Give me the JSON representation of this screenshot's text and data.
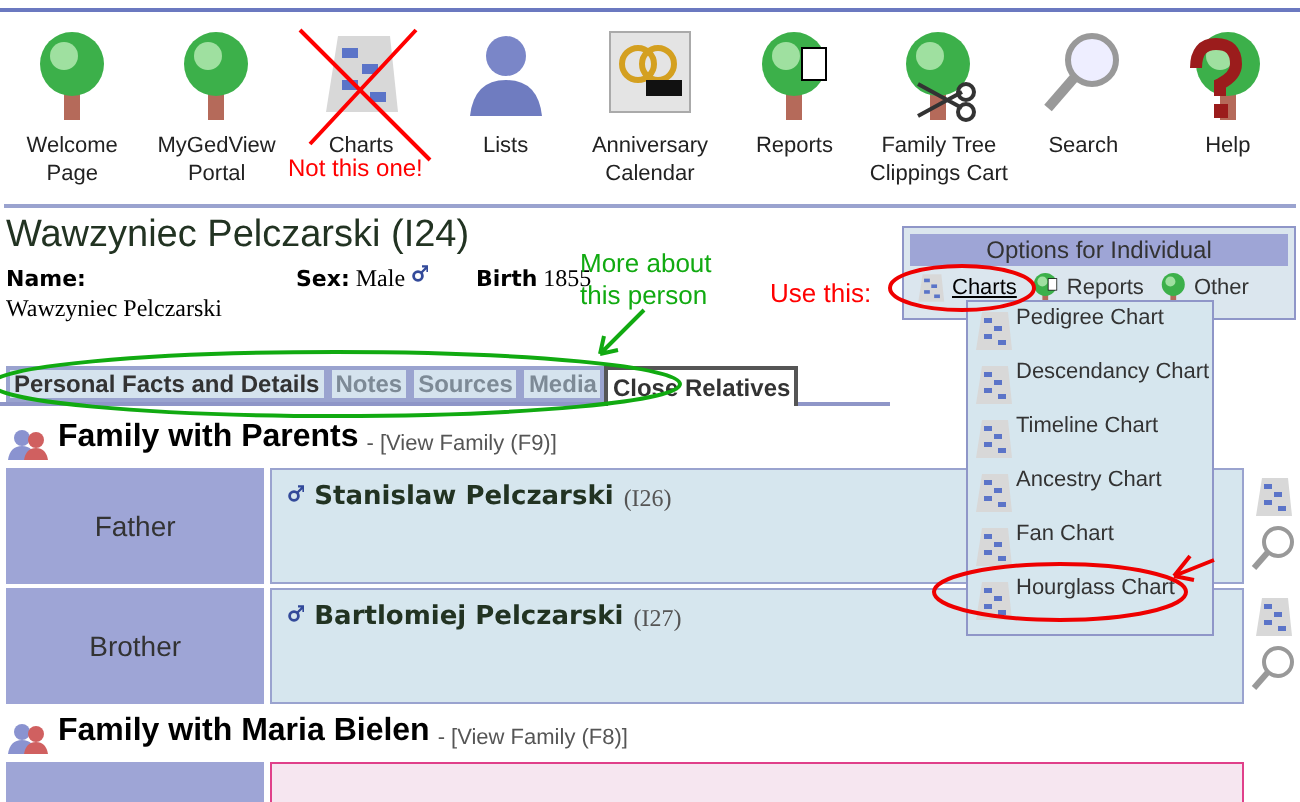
{
  "nav": [
    {
      "label": "Welcome Page",
      "kind": "tree"
    },
    {
      "label": "MyGedView Portal",
      "kind": "tree"
    },
    {
      "label": "Charts",
      "kind": "charts"
    },
    {
      "label": "Lists",
      "kind": "person"
    },
    {
      "label": "Anniversary Calendar",
      "kind": "calendar"
    },
    {
      "label": "Reports",
      "kind": "reports"
    },
    {
      "label": "Family Tree Clippings Cart",
      "kind": "clippings"
    },
    {
      "label": "Search",
      "kind": "search"
    },
    {
      "label": "Help",
      "kind": "help"
    }
  ],
  "person": {
    "title": "Wawzyniec Pelczarski (I24)",
    "name_label": "Name:",
    "name": "Wawzyniec Pelczarski",
    "sex_label": "Sex:",
    "sex": "Male",
    "birth_label": "Birth",
    "birth": "1855"
  },
  "tabs": [
    {
      "label": "Personal Facts and Details",
      "selected": false,
      "disabled": false
    },
    {
      "label": "Notes",
      "selected": false,
      "disabled": true
    },
    {
      "label": "Sources",
      "selected": false,
      "disabled": true
    },
    {
      "label": "Media",
      "selected": false,
      "disabled": true
    },
    {
      "label": "Close Relatives",
      "selected": true,
      "disabled": false
    }
  ],
  "options": {
    "title": "Options for Individual",
    "items": [
      {
        "label": "Charts",
        "kind": "charts"
      },
      {
        "label": "Reports",
        "kind": "reports"
      },
      {
        "label": "Other",
        "kind": "other"
      }
    ],
    "menu": [
      "Pedigree Chart",
      "Descendancy Chart",
      "Timeline Chart",
      "Ancestry Chart",
      "Fan Chart",
      "Hourglass Chart"
    ]
  },
  "families": [
    {
      "title": "Family with Parents",
      "link": "- [View Family (F9)]",
      "members": [
        {
          "kind": "person",
          "role": "Father",
          "name": "Stanislaw Pelczarski",
          "id": "(I26)"
        },
        {
          "kind": "person",
          "role": "Brother",
          "name": "Bartlomiej Pelczarski",
          "id": "(I27)"
        }
      ]
    },
    {
      "title": "Family with Maria Bielen",
      "link": "- [View Family (F8)]",
      "members": [
        {
          "kind": "blank"
        }
      ]
    }
  ],
  "annotations": {
    "not_this": "Not this one!",
    "use_this": "Use this:",
    "more_about": "More about this person"
  }
}
